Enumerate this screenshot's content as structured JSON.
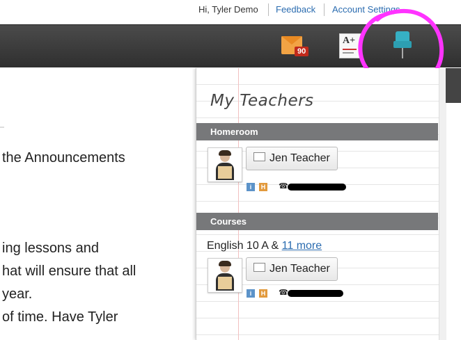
{
  "header": {
    "greeting": "Hi, Tyler Demo",
    "feedback": "Feedback",
    "account_settings": "Account Settings"
  },
  "toolbar": {
    "mail_badge": "90",
    "mail_icon": "envelope-icon",
    "grades_icon": "grade-paper-icon",
    "grade_text": "A+",
    "pin_icon": "pushpin-icon",
    "pin_color": "#36b0c4",
    "highlight_color": "#ff33ff"
  },
  "content": {
    "lines": [
      "the Announcements",
      "ing lessons and",
      "hat will ensure that all",
      "year.",
      "of time. Have Tyler"
    ]
  },
  "panel": {
    "title": "My Teachers",
    "homeroom": {
      "label": "Homeroom",
      "teacher": "Jen Teacher"
    },
    "courses": {
      "label": "Courses",
      "course_text": "English 10 A & ",
      "more_link": "11 more",
      "teacher": "Jen Teacher"
    },
    "info_glyph": "i",
    "hw_glyph": "H"
  }
}
